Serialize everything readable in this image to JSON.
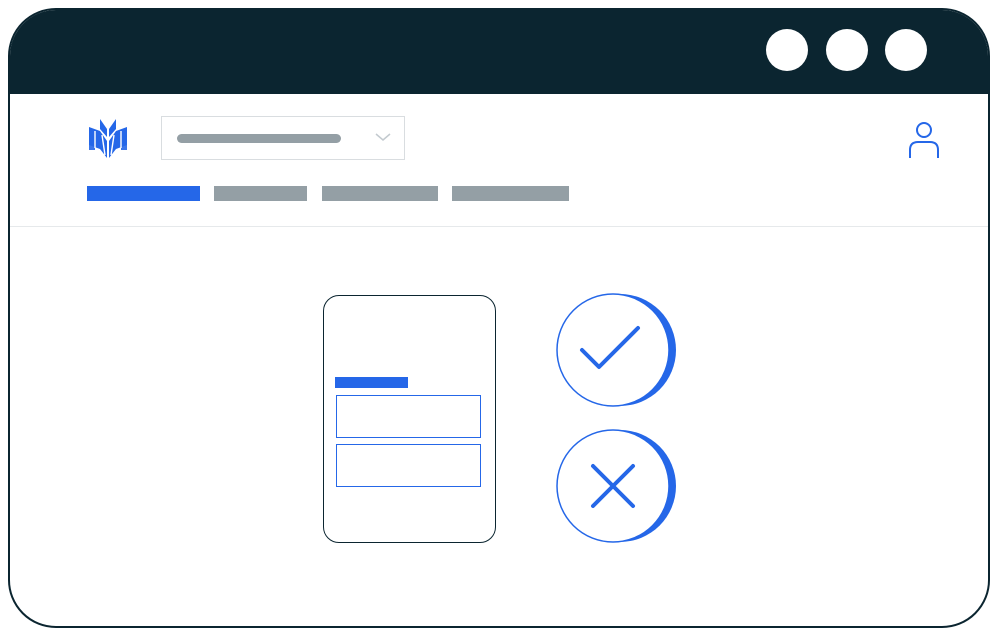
{
  "window": {
    "controls": [
      "window-dot",
      "window-dot",
      "window-dot"
    ]
  },
  "header": {
    "logo_icon": "stylized-book-logo-icon",
    "dropdown": {
      "selected_value": "",
      "placeholder_shape": "gray-text-placeholder",
      "chevron_icon": "chevron-down-icon"
    },
    "user_icon": "user-icon"
  },
  "tabs": [
    {
      "label": "",
      "active": true
    },
    {
      "label": "",
      "active": false
    },
    {
      "label": "",
      "active": false
    },
    {
      "label": "",
      "active": false
    }
  ],
  "main": {
    "phone_form": {
      "label": "",
      "fields": [
        "",
        ""
      ]
    },
    "approve_icon": "checkmark-icon",
    "reject_icon": "x-mark-icon"
  },
  "colors": {
    "titlebar": "#0b2530",
    "accent": "#2567e8",
    "muted": "#949fa5",
    "border": "#d9dde0"
  }
}
